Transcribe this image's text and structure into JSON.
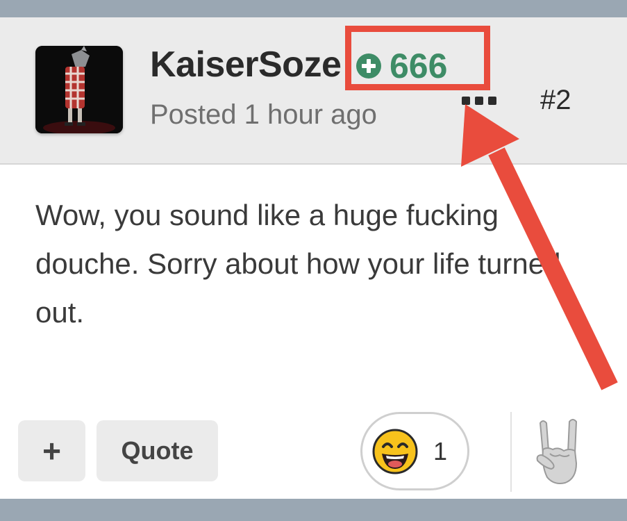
{
  "post": {
    "username": "KaiserSoze",
    "reputation": "666",
    "posted": "Posted 1 hour ago",
    "post_number": "#2",
    "body": "Wow, you sound like a huge fucking douche. Sorry about how your life turned out."
  },
  "actions": {
    "plus_label": "+",
    "quote_label": "Quote"
  },
  "reactions": {
    "count": "1"
  },
  "icons": {
    "rep_badge": "plus-circle-icon",
    "more": "ellipsis-icon",
    "reaction": "grinning-face-icon",
    "react_button": "sign-of-the-horns-icon"
  },
  "colors": {
    "reputation": "#3e8c66",
    "highlight": "#e94c3d",
    "header_bg": "#ebebeb"
  }
}
